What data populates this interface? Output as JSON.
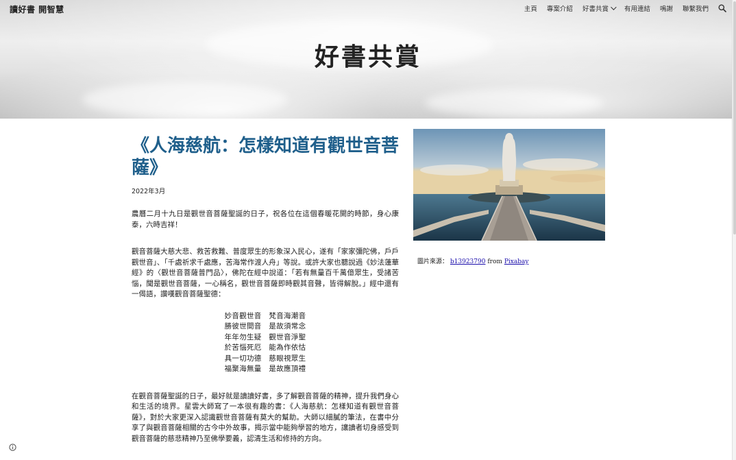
{
  "site": {
    "title": "讀好書 開智慧"
  },
  "nav": {
    "items": [
      "主頁",
      "專案介紹",
      "好書共賞",
      "有用連結",
      "鳴謝",
      "聯繫我們"
    ],
    "dropdown_index": 2
  },
  "banner": {
    "title": "好書共賞"
  },
  "article": {
    "title": "《人海慈航：怎樣知道有觀世音菩薩》",
    "date": "2022年3月",
    "p1": "農曆二月十九日是觀世音菩薩聖誕的日子，祝各位在這個春暖花開的時節，身心康泰，六時吉祥！",
    "p2": "觀音菩薩大慈大悲、救苦救難、普度眾生的形象深入民心，遂有「家家彌陀佛，戶戶觀世音」、「千處祈求千處應，苦海常作渡人舟」等說。或許大家也聽說過《妙法蓮華經》的〈觀世音菩薩普門品〉，佛陀在經中說道：「若有無量百千萬億眾生，受諸苦惱，聞是觀世音菩薩，一心稱名，觀世音菩薩即時觀其音聲，皆得解脫。」經中還有一偈語，讚嘆觀音菩薩聖德：",
    "verse": [
      "妙音觀世音　梵音海潮音",
      "勝彼世間音　是故須常念",
      "年年勿生疑　觀世音淨聖",
      "於苦惱死厄　能為作依怙",
      "具一切功德　慈眼視眾生",
      "福聚海無量　是故應頂禮"
    ],
    "p3": "在觀音菩薩聖誕的日子，最好就是讀讀好書，多了解觀音菩薩的精神，提升我們身心和生活的境界。星雲大師寫了一本很有趣的書：《人海慈航：怎樣知道有觀世音菩薩》，對於大家更深入認識觀世音菩薩有莫大的幫助。大師以細膩的筆法，在書中分享了與觀音菩薩相關的古今中外故事，揭示當中能夠學習的地方，讓讀者切身感受到觀音菩薩的慈悲精神乃至佛學要義，認清生活和修持的方向。"
  },
  "image": {
    "caption_prefix": "圖片來源：",
    "author": "b13923790",
    "from": "from",
    "source": "Pixabay"
  },
  "icons": {
    "search": "search-icon",
    "info": "info-icon",
    "chevron": "chevron-down-icon"
  }
}
